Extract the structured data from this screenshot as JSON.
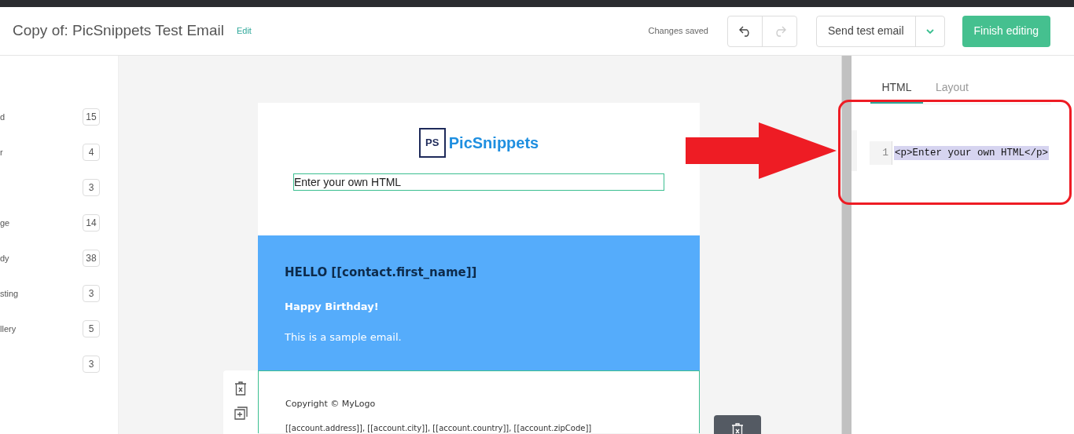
{
  "header": {
    "title": "Copy of: PicSnippets Test Email",
    "edit_link": "Edit",
    "save_status": "Changes saved",
    "undo_disabled": false,
    "redo_disabled": true,
    "send_button": "Send test email",
    "finish_button": "Finish editing"
  },
  "sidebar": {
    "items": [
      {
        "label": "d",
        "count": "15"
      },
      {
        "label": "r",
        "count": "4"
      },
      {
        "count": "3"
      },
      {
        "label": "ge",
        "count": "14"
      },
      {
        "label": "dy",
        "count": "38"
      },
      {
        "label": "sting",
        "count": "3"
      },
      {
        "label": "llery",
        "count": "5"
      },
      {
        "count": "3"
      }
    ]
  },
  "email": {
    "logo_mark": "PS",
    "logo_text": "PicSnippets",
    "html_block": "Enter your own HTML",
    "heading": "HELLO [[contact.first_name]]",
    "subheading": "Happy Birthday!",
    "body": "This is a sample email.",
    "copyright": "Copyright © MyLogo",
    "address": "[[account.address]], [[account.city]], [[account.country]], [[account.zipCode]]"
  },
  "panel": {
    "tabs": [
      {
        "label": "HTML",
        "selected": true
      },
      {
        "label": "Layout",
        "selected": false
      }
    ],
    "code": [
      {
        "line": "1",
        "text": "<p>Enter your own HTML</p>"
      }
    ]
  }
}
